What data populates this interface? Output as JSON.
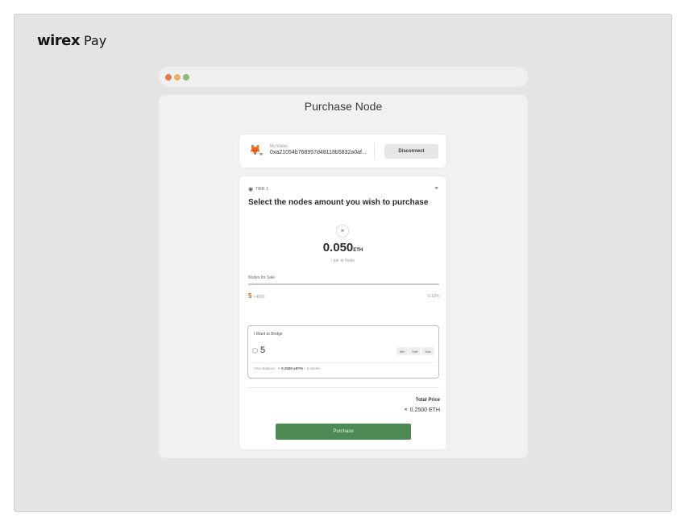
{
  "brand": {
    "logo": "wirex",
    "suffix": "Pay"
  },
  "browser": {
    "dots": [
      "#e6784e",
      "#e8b26a",
      "#8eb97a"
    ]
  },
  "page": {
    "title": "Purchase Node"
  },
  "wallet": {
    "label": "My Wallet",
    "address": "0xa21054b768957d48118b5832a0af...",
    "disconnect_label": "Disconnect",
    "icon": "metamask-fox-icon"
  },
  "card": {
    "tier": "TIER 1",
    "heading": "Select the nodes amount you wish to purchase",
    "price_value": "0.050",
    "price_unit": "ETH",
    "per_node": "/ per ⚙ Node",
    "for_sale_label": "Nodes for Sale",
    "sold": "5",
    "sold_total": "/ 4000",
    "sold_percent": "0.13%",
    "progress_fraction": 0.0013
  },
  "bridge": {
    "label": "I Want to Bridge",
    "quantity": "5",
    "buttons": [
      "Min",
      "Half",
      "Max"
    ],
    "balance_label": "Your Balance",
    "balance_value": "0.2500 vETH",
    "balance_suffix": "≈ 5 Nodes"
  },
  "total": {
    "label": "Total Price",
    "value": "0.2500 ETH"
  },
  "purchase_label": "Purchase",
  "colors": {
    "accent": "#4e8b54",
    "sold": "#d0602c"
  }
}
